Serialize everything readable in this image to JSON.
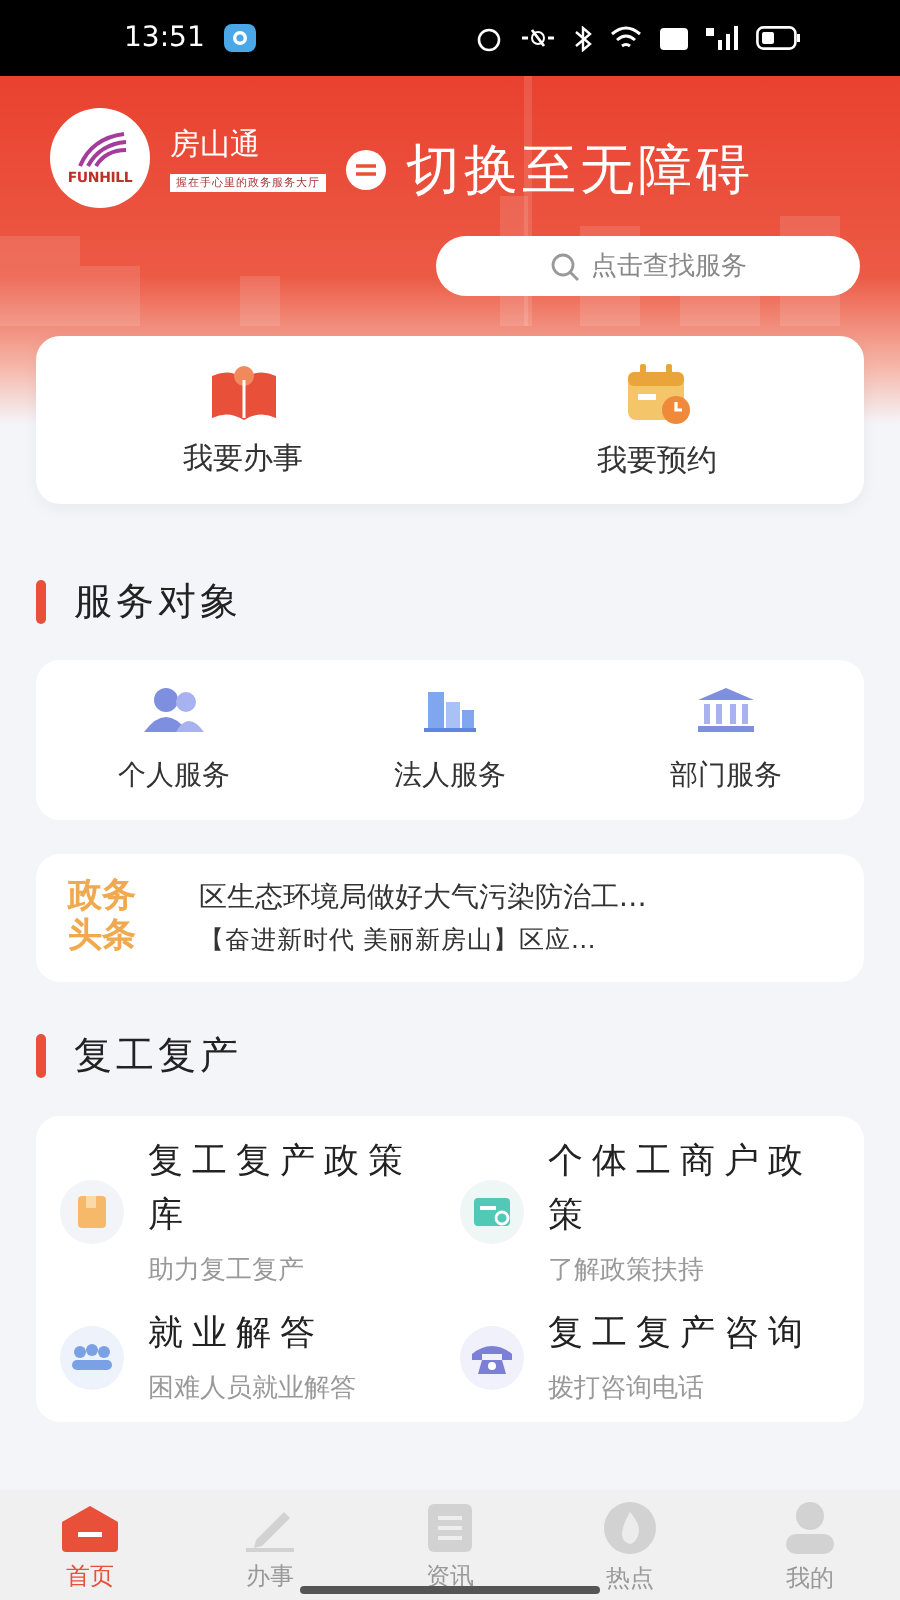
{
  "status_bar": {
    "time": "13:51"
  },
  "header": {
    "logo_text": "FUNHILL",
    "app_name": "房山通",
    "tagline": "握在手心里的政务服务大厅",
    "accessibility_link": "切换至无障碍",
    "search": {
      "placeholder": "点击查找服务"
    }
  },
  "quick_actions": [
    {
      "label": "我要办事",
      "kind": "book"
    },
    {
      "label": "我要预约",
      "kind": "calendar"
    }
  ],
  "service_targets": {
    "title": "服务对象",
    "items": [
      {
        "label": "个人服务",
        "kind": "person"
      },
      {
        "label": "法人服务",
        "kind": "building"
      },
      {
        "label": "部门服务",
        "kind": "government"
      }
    ]
  },
  "news": {
    "label": "政务头条",
    "headlines": [
      "区生态环境局做好大气污染防治工…",
      "【奋进新时代 美丽新房山】区应…"
    ]
  },
  "recovery": {
    "title": "复工复产",
    "items": [
      {
        "title": "复工复产政策库",
        "subtitle": "助力复工复产",
        "kind": "folder"
      },
      {
        "title": "个体工商户政策",
        "subtitle": "了解政策扶持",
        "kind": "card"
      },
      {
        "title": "就业解答",
        "subtitle": "困难人员就业解答",
        "kind": "people"
      },
      {
        "title": "复工复产咨询",
        "subtitle": "拨打咨询电话",
        "kind": "phone"
      }
    ]
  },
  "tab_bar": [
    {
      "label": "首页",
      "kind": "home",
      "selected": true
    },
    {
      "label": "办事",
      "kind": "pencil",
      "selected": false
    },
    {
      "label": "资讯",
      "kind": "doc",
      "selected": false
    },
    {
      "label": "热点",
      "kind": "flame",
      "selected": false
    },
    {
      "label": "我的",
      "kind": "user",
      "selected": false
    }
  ]
}
